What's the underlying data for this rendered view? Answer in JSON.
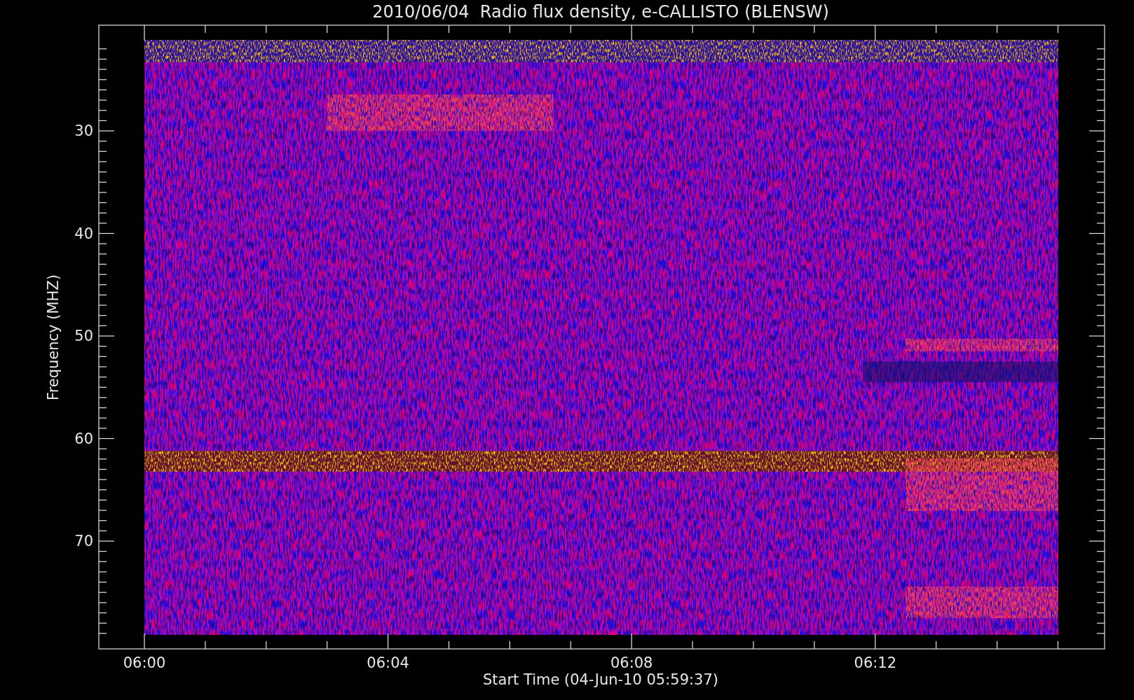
{
  "title": "2010/06/04  Radio flux density, e-CALLISTO (BLENSW)",
  "y_axis": {
    "label": "Frequency (MHZ)",
    "ticks": [
      "30",
      "40",
      "50",
      "60",
      "70"
    ]
  },
  "x_axis": {
    "label": "Start Time (04-Jun-10 05:59:37)",
    "ticks": [
      "06:00",
      "06:04",
      "06:08",
      "06:12"
    ]
  }
}
